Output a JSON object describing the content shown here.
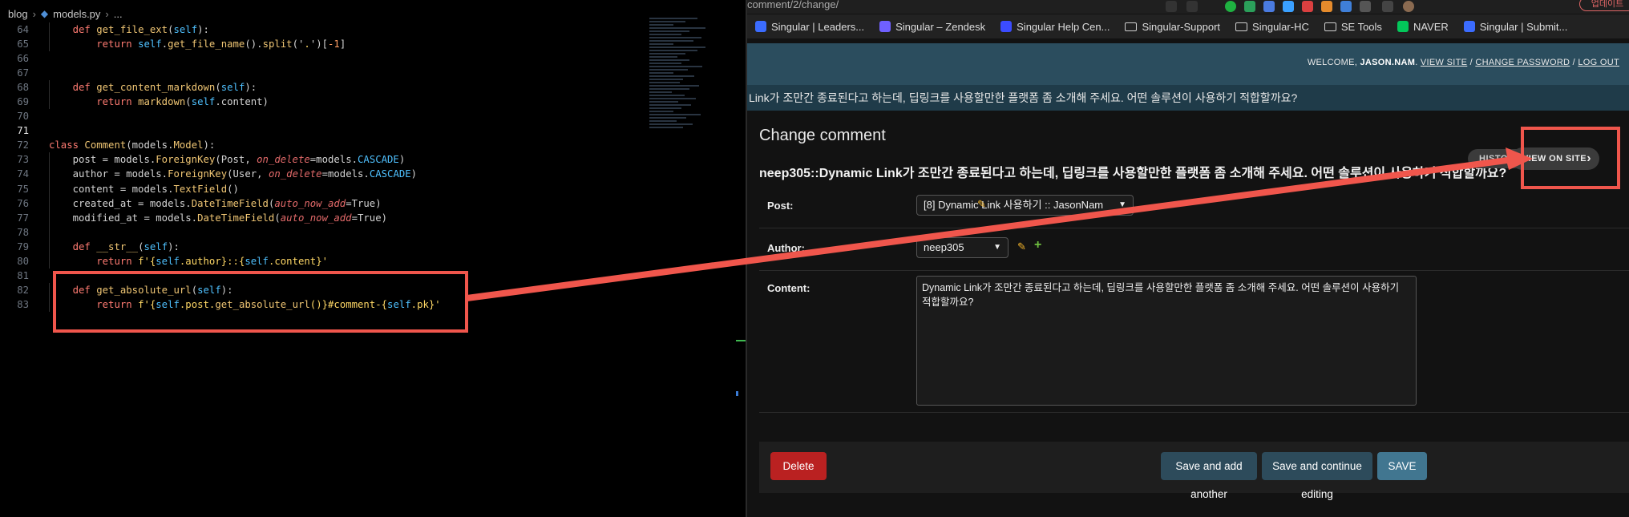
{
  "editor": {
    "breadcrumb": {
      "folder": "blog",
      "file": "models.py",
      "more": "..."
    },
    "lines": [
      {
        "n": "64",
        "segs": [
          [
            "    ",
            ""
          ],
          [
            "def ",
            "kw"
          ],
          [
            "get_file_ext",
            "fn"
          ],
          [
            "(",
            ""
          ],
          [
            "self",
            "slf"
          ],
          [
            "):",
            ""
          ]
        ]
      },
      {
        "n": "65",
        "segs": [
          [
            "        ",
            ""
          ],
          [
            "return ",
            "kw"
          ],
          [
            "self",
            "slf"
          ],
          [
            ".",
            ""
          ],
          [
            "get_file_name",
            "fn"
          ],
          [
            "().",
            ""
          ],
          [
            "split",
            "fn"
          ],
          [
            "('",
            ""
          ],
          [
            ".",
            "str"
          ],
          [
            "')[",
            ""
          ],
          [
            "-1",
            "num"
          ],
          [
            "]",
            ""
          ]
        ]
      },
      {
        "n": "66",
        "segs": []
      },
      {
        "n": "67",
        "segs": []
      },
      {
        "n": "68",
        "segs": [
          [
            "    ",
            ""
          ],
          [
            "def ",
            "kw"
          ],
          [
            "get_content_markdown",
            "fn"
          ],
          [
            "(",
            ""
          ],
          [
            "self",
            "slf"
          ],
          [
            "):",
            ""
          ]
        ]
      },
      {
        "n": "69",
        "segs": [
          [
            "        ",
            ""
          ],
          [
            "return ",
            "kw"
          ],
          [
            "markdown",
            "fn"
          ],
          [
            "(",
            ""
          ],
          [
            "self",
            "slf"
          ],
          [
            ".content)",
            ""
          ]
        ]
      },
      {
        "n": "70",
        "segs": []
      },
      {
        "n": "71",
        "segs": [],
        "active": true
      },
      {
        "n": "72",
        "segs": [
          [
            "class ",
            "kw"
          ],
          [
            "Comment",
            "cls"
          ],
          [
            "(models.",
            ""
          ],
          [
            "Model",
            "cls"
          ],
          [
            "):",
            ""
          ]
        ]
      },
      {
        "n": "73",
        "segs": [
          [
            "    post = models.",
            ""
          ],
          [
            "ForeignKey",
            "fn"
          ],
          [
            "(Post, ",
            ""
          ],
          [
            "on_delete",
            "prm"
          ],
          [
            "=models.",
            ""
          ],
          [
            "CASCADE",
            "attr"
          ],
          [
            ")",
            ""
          ]
        ]
      },
      {
        "n": "74",
        "segs": [
          [
            "    author = models.",
            ""
          ],
          [
            "ForeignKey",
            "fn"
          ],
          [
            "(User, ",
            ""
          ],
          [
            "on_delete",
            "prm"
          ],
          [
            "=models.",
            ""
          ],
          [
            "CASCADE",
            "attr"
          ],
          [
            ")",
            ""
          ]
        ]
      },
      {
        "n": "75",
        "segs": [
          [
            "    content = models.",
            ""
          ],
          [
            "TextField",
            "fn"
          ],
          [
            "()",
            ""
          ]
        ]
      },
      {
        "n": "76",
        "segs": [
          [
            "    created_at = models.",
            ""
          ],
          [
            "DateTimeField",
            "fn"
          ],
          [
            "(",
            ""
          ],
          [
            "auto_now_add",
            "prm"
          ],
          [
            "=True)",
            ""
          ]
        ]
      },
      {
        "n": "77",
        "segs": [
          [
            "    modified_at = models.",
            ""
          ],
          [
            "DateTimeField",
            "fn"
          ],
          [
            "(",
            ""
          ],
          [
            "auto_now_add",
            "prm"
          ],
          [
            "=True)",
            ""
          ]
        ]
      },
      {
        "n": "78",
        "segs": []
      },
      {
        "n": "79",
        "segs": [
          [
            "    ",
            ""
          ],
          [
            "def ",
            "kw"
          ],
          [
            "__str__",
            "fn"
          ],
          [
            "(",
            ""
          ],
          [
            "self",
            "slf"
          ],
          [
            "):",
            ""
          ]
        ]
      },
      {
        "n": "80",
        "segs": [
          [
            "        ",
            ""
          ],
          [
            "return ",
            "kw"
          ],
          [
            "f'{",
            "str"
          ],
          [
            "self",
            "slf"
          ],
          [
            ".author}::{",
            "str"
          ],
          [
            "self",
            "slf"
          ],
          [
            ".content}'",
            "str"
          ]
        ]
      },
      {
        "n": "81",
        "segs": []
      },
      {
        "n": "82",
        "segs": [
          [
            "    ",
            ""
          ],
          [
            "def ",
            "kw"
          ],
          [
            "get_absolute_url",
            "fn"
          ],
          [
            "(",
            ""
          ],
          [
            "self",
            "slf"
          ],
          [
            "):",
            ""
          ]
        ]
      },
      {
        "n": "83",
        "segs": [
          [
            "        ",
            ""
          ],
          [
            "return ",
            "kw"
          ],
          [
            "f'{",
            "str"
          ],
          [
            "self",
            "slf"
          ],
          [
            ".post.",
            "str"
          ],
          [
            "get_absolute_url",
            "fn"
          ],
          [
            "()}#comment-{",
            "str"
          ],
          [
            "self",
            "slf"
          ],
          [
            ".pk}'",
            "str"
          ]
        ]
      }
    ]
  },
  "browser": {
    "url_fragment": "comment/2/change/",
    "update_button": "업데이트",
    "bookmarks": [
      {
        "label": "Singular | Leaders...",
        "icon": "singular-icon",
        "color": "#3b6cff"
      },
      {
        "label": "Singular – Zendesk",
        "icon": "zendesk-icon",
        "color": "#6f60ff"
      },
      {
        "label": "Singular Help Cen...",
        "icon": "help-center-icon",
        "color": "#3b4cff"
      },
      {
        "label": "Singular-Support",
        "icon": "folder-icon",
        "color": ""
      },
      {
        "label": "Singular-HC",
        "icon": "folder-icon",
        "color": ""
      },
      {
        "label": "SE Tools",
        "icon": "folder-icon",
        "color": ""
      },
      {
        "label": "NAVER",
        "icon": "naver-icon",
        "color": "#03c75a"
      },
      {
        "label": "Singular | Submit...",
        "icon": "singular-icon",
        "color": "#3b6cff"
      }
    ],
    "welcome": {
      "prefix": "WELCOME,",
      "user": "JASON.NAM",
      "links": [
        "VIEW SITE",
        "CHANGE PASSWORD",
        "LOG OUT"
      ],
      "separator": "/"
    },
    "crumbs": "Link가 조만간 종료된다고 하는데, 딥링크를 사용할만한 플랫폼 좀 소개해 주세요. 어떤 솔루션이 사용하기 적합할까요?",
    "page_title": "Change comment",
    "object_title": "neep305::Dynamic Link가 조만간 종료된다고 하는데, 딥링크를 사용할만한 플랫폼 좀 소개해 주세요. 어떤 솔루션이 사용하기 적합할까요?",
    "history_button": "HISTORY",
    "view_on_site_button": "VIEW ON SITE",
    "form": {
      "post_label": "Post:",
      "post_value": "[8] Dynamic Link 사용하기 :: JasonNam",
      "author_label": "Author:",
      "author_value": "neep305",
      "content_label": "Content:",
      "content_value": "Dynamic Link가 조만간 종료된다고 하는데, 딥링크를 사용할만한 플랫폼 좀 소개해 주세요. 어떤 솔루션이 사용하기 적합할까요?"
    },
    "buttons": {
      "delete": "Delete",
      "save_add_another": "Save and add another",
      "save_continue": "Save and continue editing",
      "save": "SAVE"
    }
  },
  "annotation": {
    "color": "#f0564c"
  }
}
